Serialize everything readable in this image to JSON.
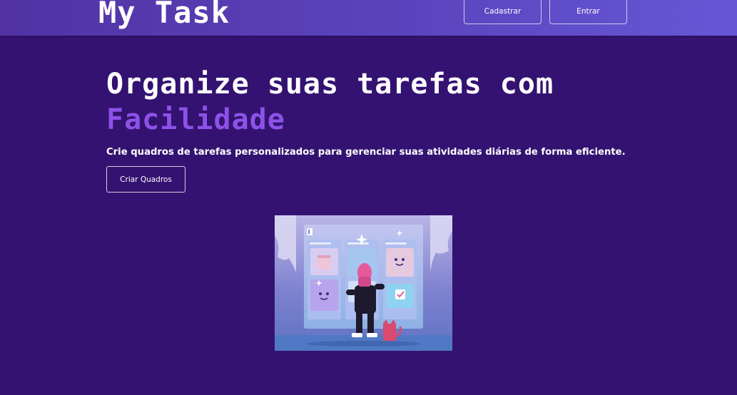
{
  "header": {
    "logo": "My Task",
    "nav": {
      "register_label": "Cadastrar",
      "login_label": "Entrar"
    }
  },
  "hero": {
    "title": "Organize suas tarefas com",
    "highlight": "Facilidade",
    "subtitle": "Crie quadros de tarefas personalizados para gerenciar suas atividades diárias de forma eficiente.",
    "cta_label": "Criar Quadros"
  },
  "illustration": {
    "icon": "kanban-board-illustration"
  },
  "colors": {
    "background": "#341271",
    "header_start": "#5232a3",
    "header_end": "#6757d6",
    "highlight": "#8c52e8"
  }
}
